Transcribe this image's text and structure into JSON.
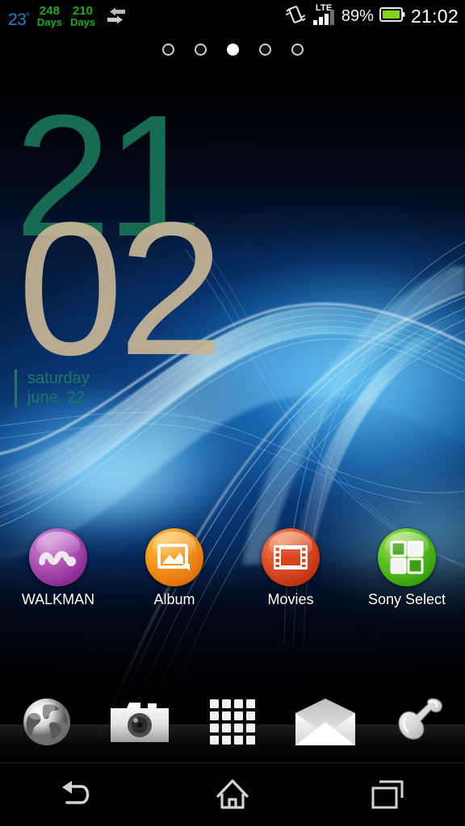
{
  "status_bar": {
    "temperature": "23",
    "temperature_unit": "º",
    "counter_1": {
      "number": "248",
      "unit": "Days"
    },
    "counter_2": {
      "number": "210",
      "unit": "Days"
    },
    "sync_icon": "data-transfer-icon",
    "vibrate_icon": "vibrate-mode-icon",
    "network_type": "LTE",
    "signal_bars_filled": 3,
    "signal_bars_total": 4,
    "battery_percent": "89%",
    "battery_level": 89,
    "clock": "21:02",
    "colors": {
      "temperature": "#2a7fc4",
      "counter": "#1faa1f",
      "battery_fill": "#7ed321",
      "text": "#ffffff"
    }
  },
  "page_indicator": {
    "total_pages": 5,
    "active_page": 3
  },
  "clock_widget": {
    "hours": "21",
    "minutes": "02",
    "weekday": "saturday",
    "date": "june. 22",
    "colors": {
      "hours": "#186b53",
      "minutes": "#c6b596",
      "date": "#1d7a5f"
    }
  },
  "apps": [
    {
      "label": "WALKMAN",
      "icon": "walkman-icon",
      "color": "#b357b8"
    },
    {
      "label": "Album",
      "icon": "photo-album-icon",
      "color": "#f79a1e"
    },
    {
      "label": "Movies",
      "icon": "film-strip-icon",
      "color": "#e2542a"
    },
    {
      "label": "Sony Select",
      "icon": "grid-squares-icon",
      "color": "#5fc224"
    }
  ],
  "dock": [
    {
      "name": "browser",
      "icon": "globe-icon"
    },
    {
      "name": "camera",
      "icon": "camera-icon"
    },
    {
      "name": "app-drawer",
      "icon": "app-grid-icon"
    },
    {
      "name": "email",
      "icon": "envelope-icon"
    },
    {
      "name": "phone",
      "icon": "phone-handset-icon"
    }
  ],
  "nav_bar": [
    {
      "name": "back",
      "icon": "back-arrow-icon"
    },
    {
      "name": "home",
      "icon": "home-icon"
    },
    {
      "name": "recents",
      "icon": "recent-apps-icon"
    }
  ],
  "wallpaper": {
    "description": "xperia-blue-waves",
    "base_color": "#03142e",
    "accent_color": "#6fd6ff"
  }
}
